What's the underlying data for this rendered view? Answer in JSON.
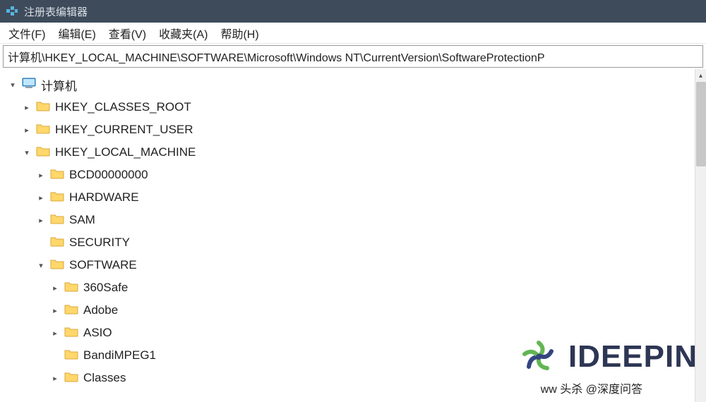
{
  "window": {
    "title": "注册表编辑器"
  },
  "menu": {
    "file": "文件(F)",
    "edit": "编辑(E)",
    "view": "查看(V)",
    "favorites": "收藏夹(A)",
    "help": "帮助(H)"
  },
  "address": {
    "path": "计算机\\HKEY_LOCAL_MACHINE\\SOFTWARE\\Microsoft\\Windows NT\\CurrentVersion\\SoftwareProtectionP"
  },
  "tree": {
    "root": {
      "label": "计算机",
      "expanded": true
    },
    "hklm_classes": {
      "label": "HKEY_CLASSES_ROOT"
    },
    "hkcu": {
      "label": "HKEY_CURRENT_USER"
    },
    "hklm": {
      "label": "HKEY_LOCAL_MACHINE",
      "expanded": true
    },
    "bcd": {
      "label": "BCD00000000"
    },
    "hardware": {
      "label": "HARDWARE"
    },
    "sam": {
      "label": "SAM"
    },
    "security": {
      "label": "SECURITY"
    },
    "software": {
      "label": "SOFTWARE",
      "expanded": true
    },
    "s_360safe": {
      "label": "360Safe"
    },
    "s_adobe": {
      "label": "Adobe"
    },
    "s_asio": {
      "label": "ASIO"
    },
    "s_bandimpeg1": {
      "label": "BandiMPEG1"
    },
    "s_classes": {
      "label": "Classes"
    }
  },
  "watermark": {
    "brand": "IDEEPIN",
    "text": "ww 头杀 @深度问答"
  },
  "icons": {
    "folder_color": "#ffd76b",
    "folder_stroke": "#d9a93a"
  }
}
